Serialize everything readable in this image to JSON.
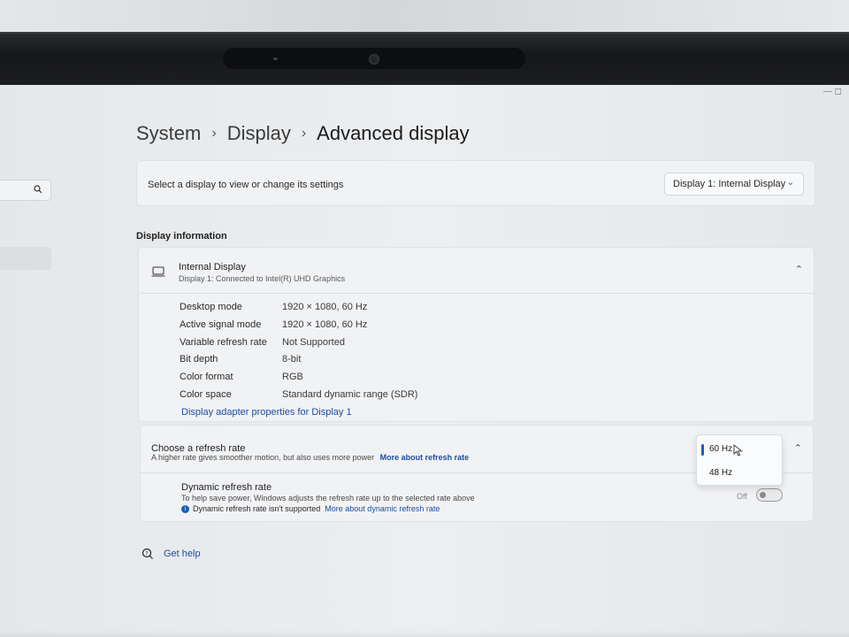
{
  "window": {
    "controls": "—   ◻"
  },
  "sidebar": {
    "search_icon": "search-icon"
  },
  "breadcrumb": {
    "items": [
      "System",
      "Display"
    ],
    "current": "Advanced display",
    "separator": "›"
  },
  "select_display": {
    "label": "Select a display to view or change its settings",
    "dropdown_value": "Display 1: Internal Display",
    "chevron": "⌄"
  },
  "display_information": {
    "heading": "Display information",
    "title": "Internal Display",
    "subtitle": "Display 1: Connected to Intel(R) UHD Graphics",
    "collapse_icon": "⌃",
    "rows": [
      {
        "key": "Desktop mode",
        "value": "1920 × 1080, 60 Hz"
      },
      {
        "key": "Active signal mode",
        "value": "1920 × 1080, 60 Hz"
      },
      {
        "key": "Variable refresh rate",
        "value": "Not Supported"
      },
      {
        "key": "Bit depth",
        "value": "8-bit"
      },
      {
        "key": "Color format",
        "value": "RGB"
      },
      {
        "key": "Color space",
        "value": "Standard dynamic range (SDR)"
      }
    ],
    "adapter_link": "Display adapter properties for Display 1"
  },
  "refresh_rate": {
    "title": "Choose a refresh rate",
    "subtitle": "A higher rate gives smoother motion, but also uses more power",
    "link": "More about refresh rate",
    "collapse_icon": "⌃",
    "options": [
      {
        "label": "60 Hz",
        "selected": true
      },
      {
        "label": "48 Hz",
        "selected": false
      }
    ]
  },
  "dynamic_refresh": {
    "title": "Dynamic refresh rate",
    "subtitle": "To help save power, Windows adjusts the refresh rate up to the selected rate above",
    "note": "Dynamic refresh rate isn't supported",
    "note_link": "More about dynamic refresh rate",
    "toggle_label": "Off",
    "toggle_on": false
  },
  "help": {
    "label": "Get help"
  },
  "colors": {
    "accent": "#1a5fb4",
    "link": "#1c4fa0",
    "card_bg": "#f1f2f4",
    "page_bg": "#eceef0"
  }
}
